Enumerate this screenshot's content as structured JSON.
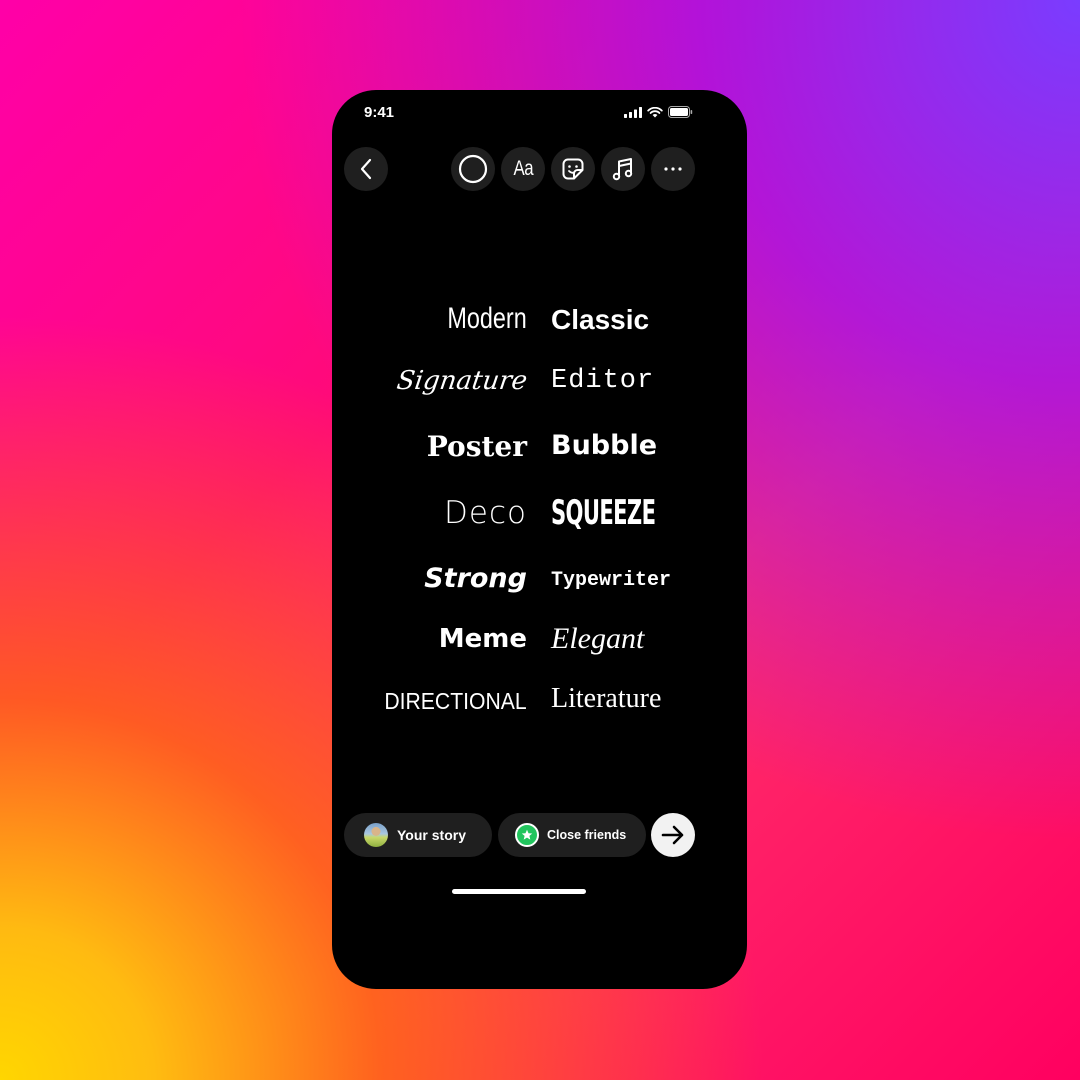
{
  "status_bar": {
    "time": "9:41",
    "icons": [
      "signal-icon",
      "wifi-icon",
      "battery-icon"
    ]
  },
  "toolbar": {
    "back_icon": "chevron-left-icon",
    "tools": [
      {
        "name": "draw-circle-tool",
        "icon": "circle-icon"
      },
      {
        "name": "text-tool",
        "icon": "text-aa-icon",
        "label": "Aa"
      },
      {
        "name": "sticker-tool",
        "icon": "sticker-icon"
      },
      {
        "name": "music-tool",
        "icon": "music-note-icon"
      },
      {
        "name": "more-tool",
        "icon": "more-horizontal-icon",
        "label": "···"
      }
    ]
  },
  "fonts": {
    "left": [
      "Modern",
      "Signature",
      "Poster",
      "Deco",
      "Strong",
      "Meme",
      "DIRECTIONAL"
    ],
    "right": [
      "Classic",
      "Editor",
      "Bubble",
      "SQUEEZE",
      "Typewriter",
      "Elegant",
      "Literature"
    ]
  },
  "share": {
    "your_story_label": "Your story",
    "close_friends_label": "Close friends",
    "close_friends_color": "#22c55e",
    "next_icon": "arrow-right-icon"
  },
  "colors": {
    "phone_bg": "#000000",
    "button_bg": "#1f1f1f",
    "next_button_bg": "#f2f2f2"
  }
}
